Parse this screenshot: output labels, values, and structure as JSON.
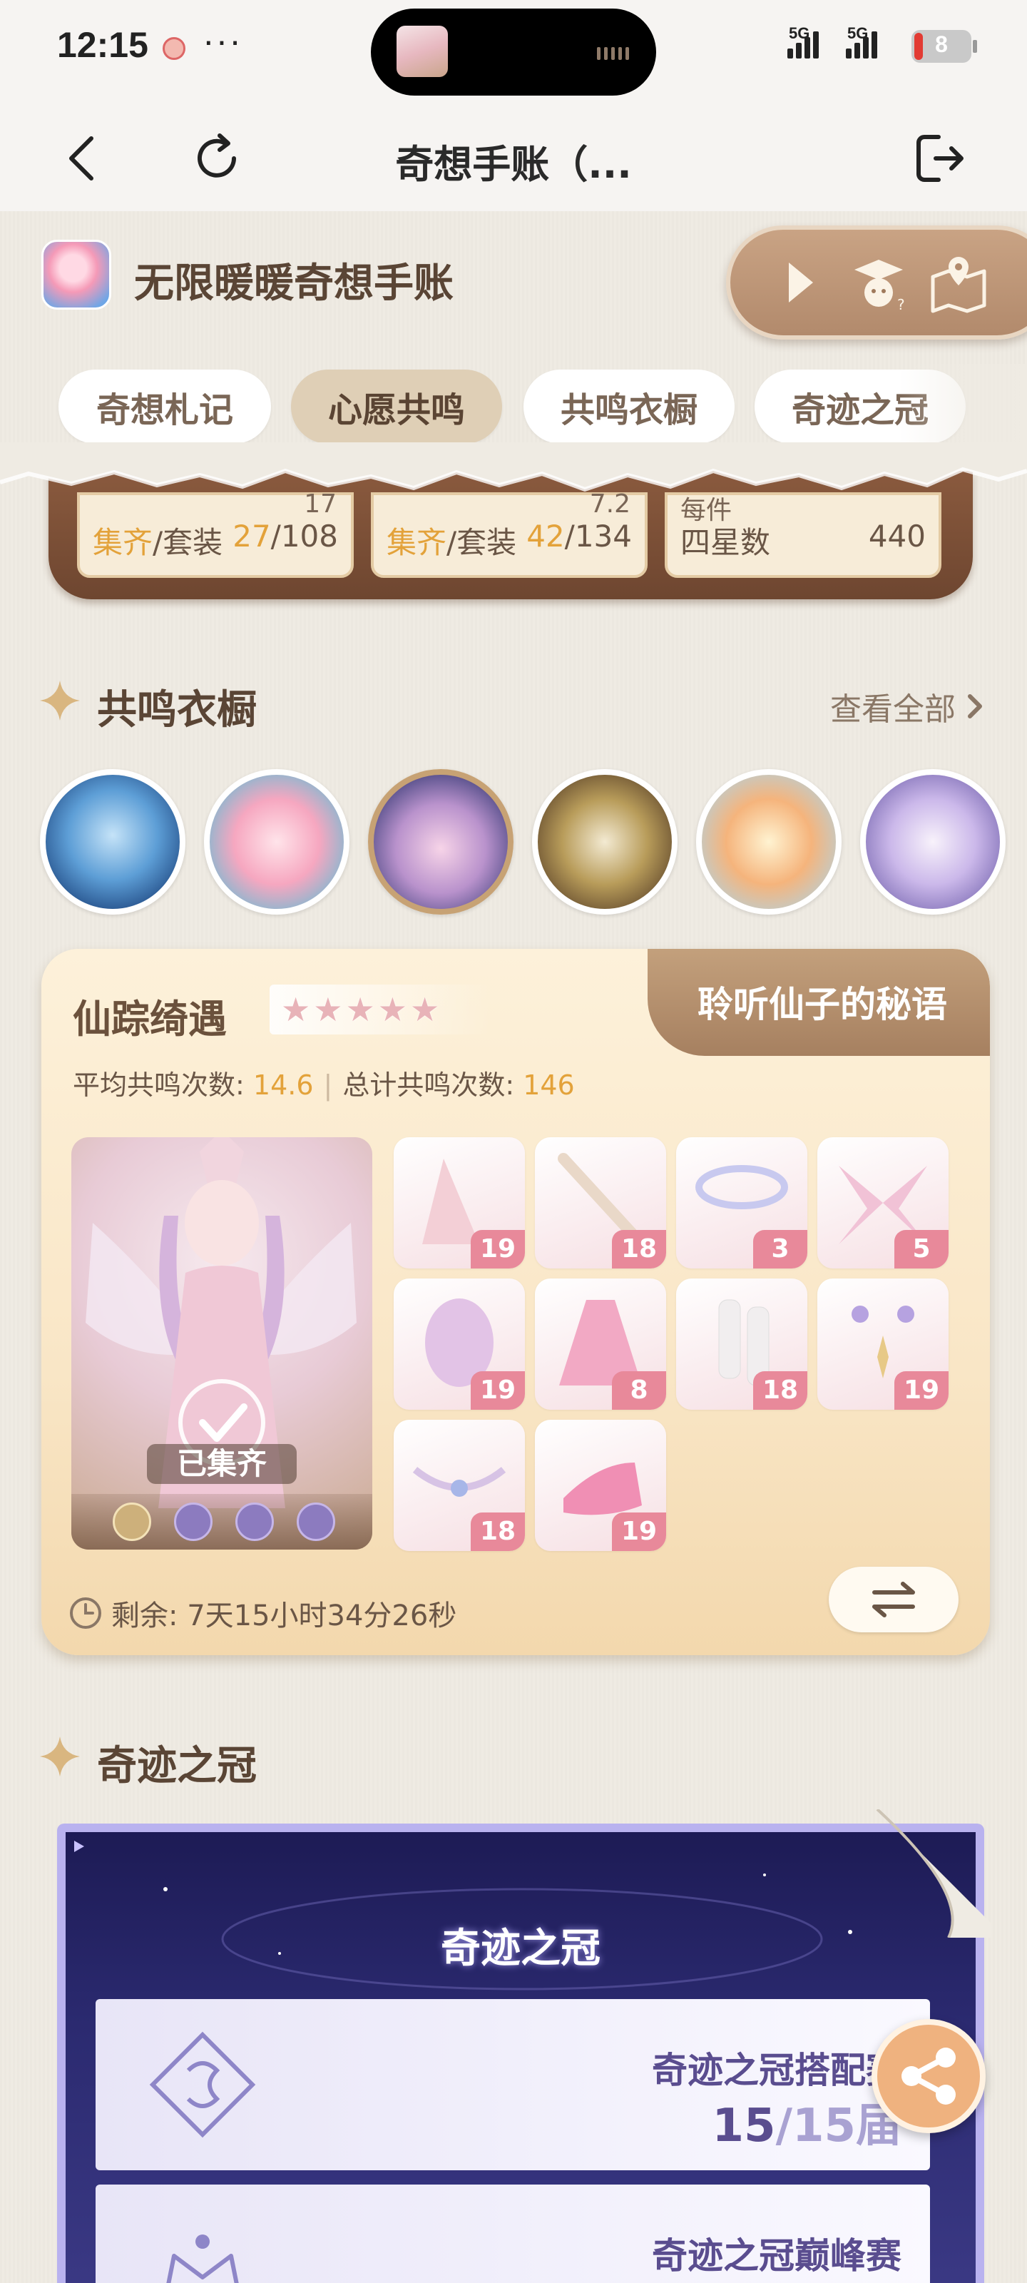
{
  "status_bar": {
    "time": "12:15",
    "dots": "···",
    "network_1": "5G",
    "network_2": "5G",
    "battery": "8"
  },
  "nav": {
    "title": "奇想手账（..."
  },
  "app": {
    "name": "无限暖暖奇想手账"
  },
  "tabs": [
    {
      "label": "奇想札记"
    },
    {
      "label": "心愿共鸣"
    },
    {
      "label": "共鸣衣橱"
    },
    {
      "label": "奇迹之冠"
    }
  ],
  "active_tab": "心愿共鸣",
  "summary": {
    "cards": [
      {
        "top": "17",
        "label_hl": "集齐",
        "label": "/套装",
        "value_hl": "27",
        "value": "/108"
      },
      {
        "top": "7.2",
        "label_hl": "集齐",
        "label": "/套装",
        "value_hl": "42",
        "value": "/134"
      },
      {
        "top": "每件",
        "label_hl": "",
        "label": "四星数",
        "value_hl": "",
        "value": "440"
      }
    ]
  },
  "wardrobe": {
    "title": "共鸣衣橱",
    "view_all": "查看全部"
  },
  "event": {
    "title": "仙踪绮遇",
    "banner": "聆听仙子的秘语",
    "avg_label": "平均共鸣次数: ",
    "avg_value": "14.6",
    "total_label": "总计共鸣次数: ",
    "total_value": "146",
    "collected": "已集齐",
    "pieces": [
      "19",
      "18",
      "3",
      "5",
      "19",
      "8",
      "18",
      "19",
      "18",
      "19"
    ],
    "remaining": "剩余: 7天15小时34分26秒"
  },
  "crown_section": {
    "title": "奇迹之冠",
    "card_title": "奇迹之冠",
    "rows": [
      {
        "title": "奇迹之冠搭配赛",
        "count": "15",
        "total": "/15",
        "partial_glyph": "届"
      },
      {
        "title": "奇迹之冠巅峰赛",
        "count": "",
        "total": ""
      }
    ]
  },
  "colors": {
    "accent": "#e3a23a",
    "brown": "#6e4630",
    "tab_active": "#dfcfb6",
    "piece_badge": "#e8899a",
    "crown_bg": "#2b2a70"
  }
}
